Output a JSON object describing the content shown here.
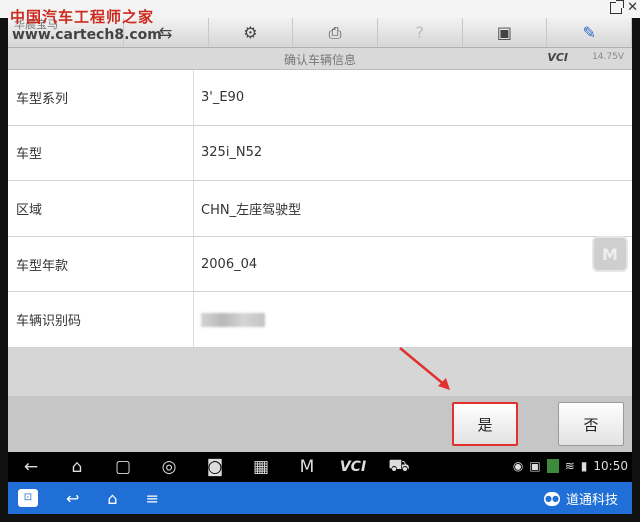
{
  "watermark": {
    "cn": "中国汽车工程师之家",
    "url": "www.cartech8.com"
  },
  "toolbar": {
    "home_label": "华晨宝马",
    "buttons": [
      {
        "name": "home",
        "icon": "⌂"
      },
      {
        "name": "vehicle-swap",
        "icon": "⇆"
      },
      {
        "name": "settings",
        "icon": "⚙"
      },
      {
        "name": "print",
        "icon": "⎙"
      },
      {
        "name": "help",
        "icon": "?"
      },
      {
        "name": "save",
        "icon": "▣"
      },
      {
        "name": "edit",
        "icon": "✎"
      }
    ]
  },
  "title_bar": {
    "title": "确认车辆信息",
    "vci": "VCI",
    "battery": "14.75V"
  },
  "vehicle_info": [
    {
      "label": "车型系列",
      "value": "3'_E90"
    },
    {
      "label": "车型",
      "value": "325i_N52"
    },
    {
      "label": "区域",
      "value": "CHN_左座驾驶型"
    },
    {
      "label": "车型年款",
      "value": "2006_04"
    },
    {
      "label": "车辆识别码",
      "value": ""
    }
  ],
  "float_button": "M",
  "actions": {
    "yes": "是",
    "no": "否"
  },
  "android_bar": {
    "vci_label": "VCI",
    "time": "10:50"
  },
  "bottom_bar": {
    "brand": "道通科技"
  },
  "colors": {
    "accent_red": "#e03030",
    "bottom_blue": "#1f6fd6"
  }
}
